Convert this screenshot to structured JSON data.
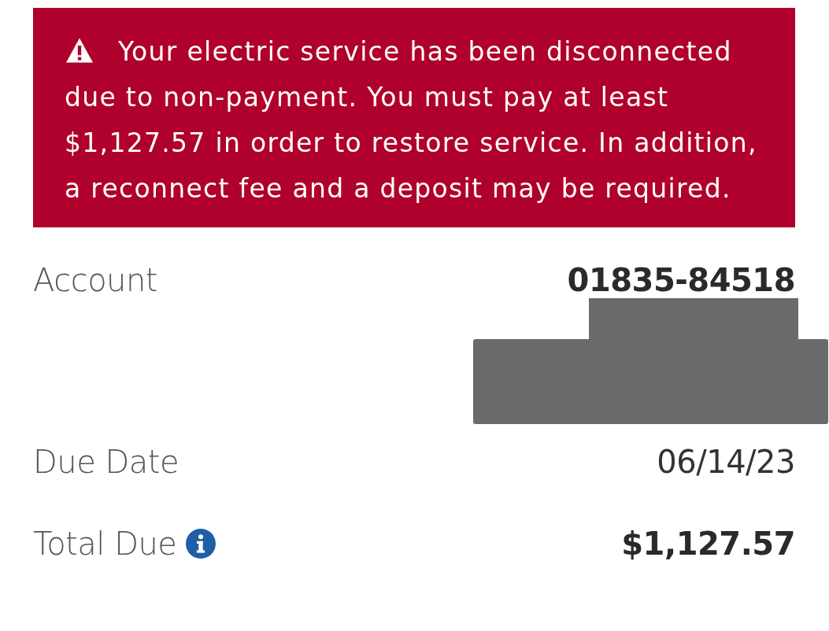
{
  "alert": {
    "text": "Your electric service has been disconnected due to non-payment. You must pay at least $1,127.57 in order to restore service. In addition, a reconnect fee and a deposit may be required."
  },
  "account": {
    "label": "Account",
    "value": "01835-84518"
  },
  "details": [
    {
      "label": "Due Date",
      "value": "06/14/23",
      "bold": false,
      "info": false
    },
    {
      "label": "Total Due",
      "value": "$1,127.57",
      "bold": true,
      "info": true
    }
  ]
}
